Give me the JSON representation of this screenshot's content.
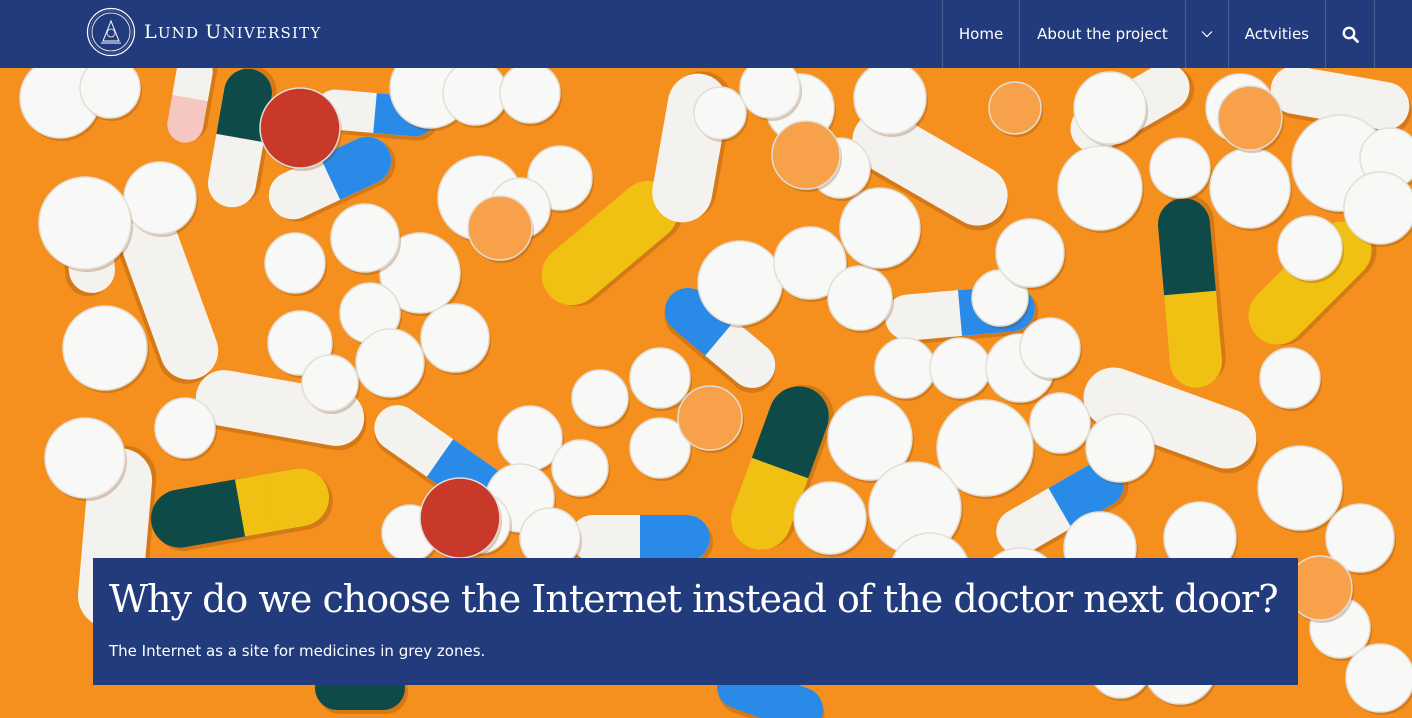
{
  "header": {
    "logo_text_first": "L",
    "logo_text_first_rest": "UND",
    "logo_text_second": "U",
    "logo_text_second_rest": "NIVERSITY",
    "logo_icon": "university-seal-icon"
  },
  "nav": {
    "home": "Home",
    "about": "About the project",
    "chevron_icon": "chevron-down-icon",
    "activities": "Actvities",
    "search_icon": "search-icon"
  },
  "hero": {
    "image_subject": "pills-on-orange-background",
    "title": "Why do we choose the Internet instead of the doctor next door?",
    "subtitle": "The Internet as a site for medicines in grey zones."
  },
  "colors": {
    "brand_blue": "#223b7c",
    "background_orange": "#f5901e"
  }
}
